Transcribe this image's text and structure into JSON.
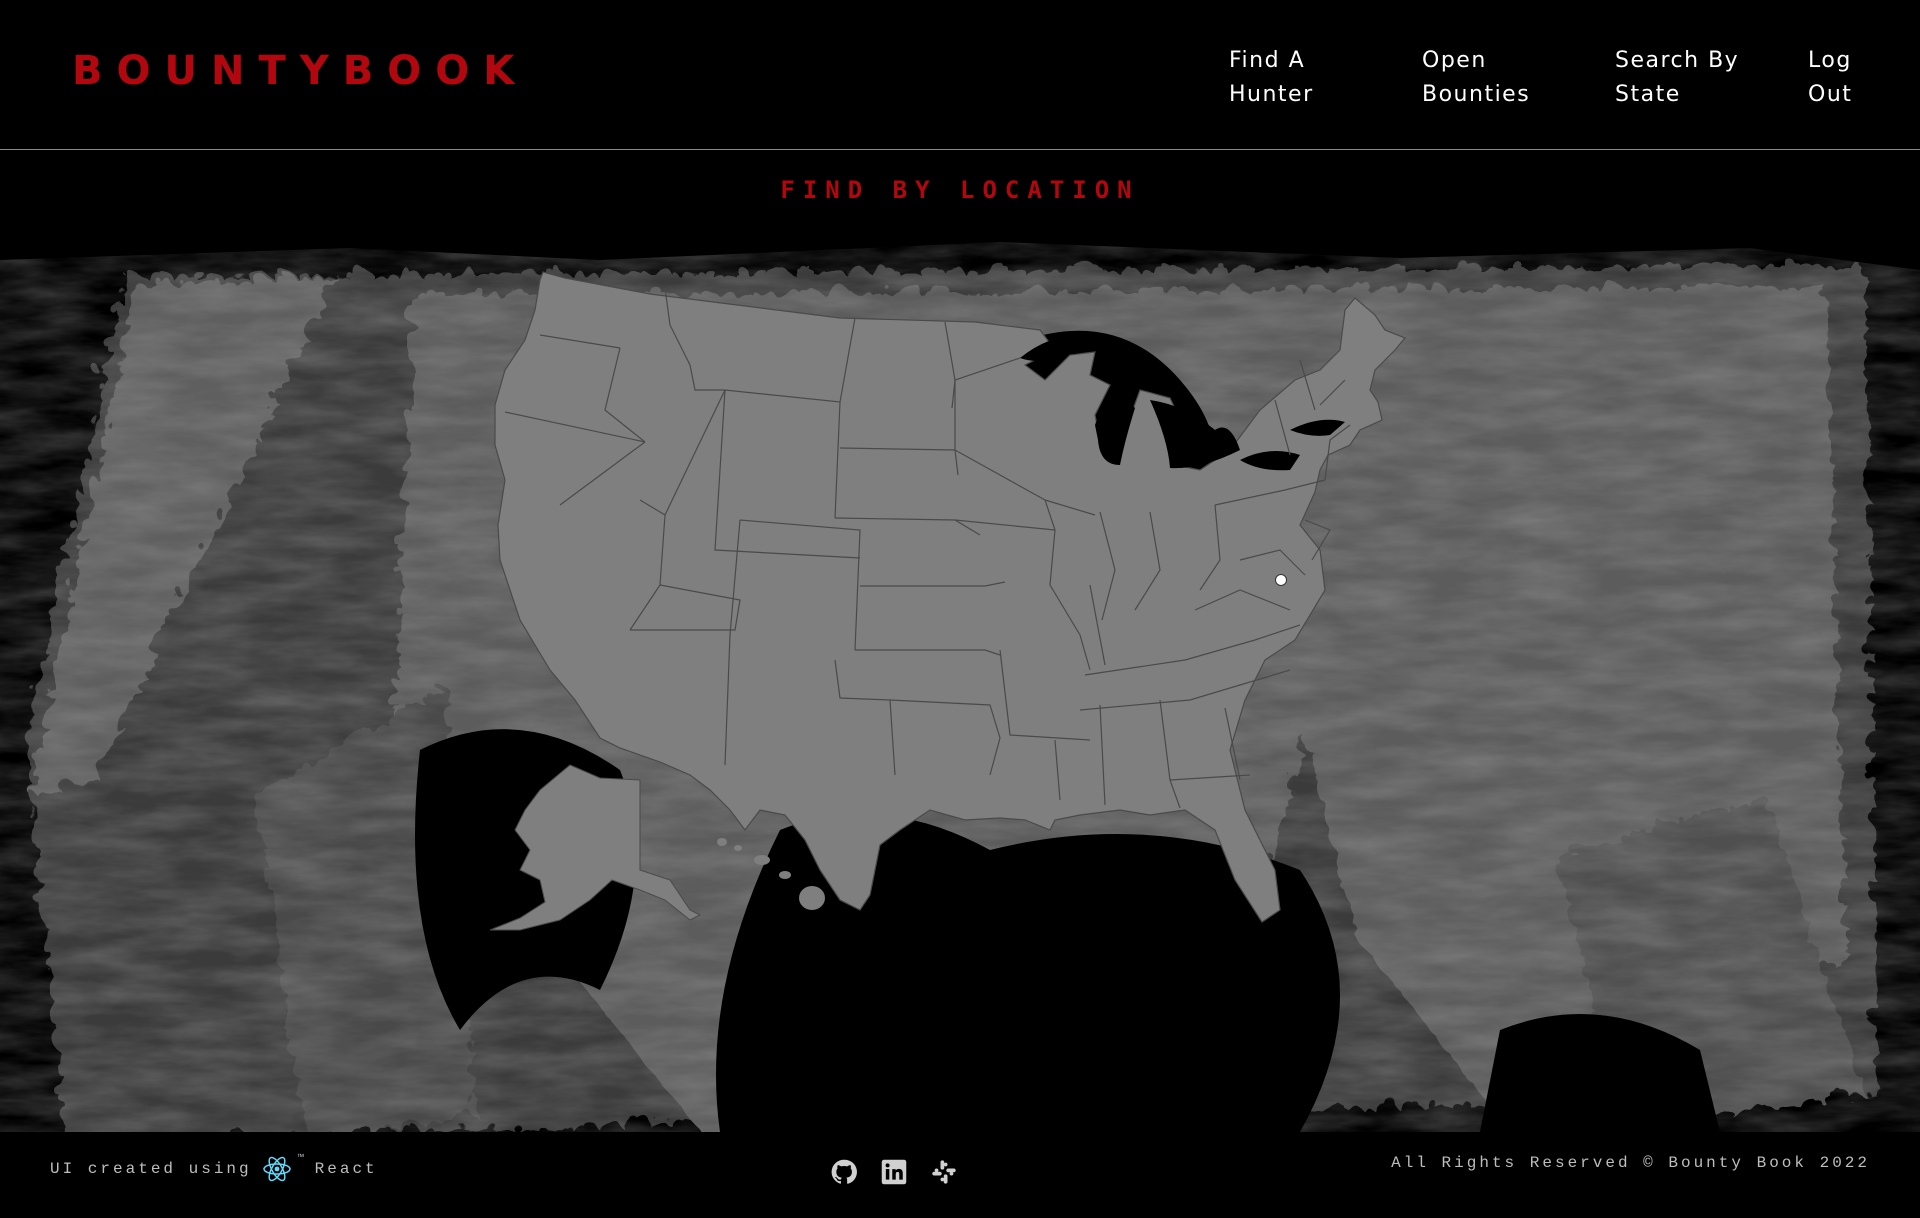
{
  "header": {
    "logo": "BOUNTYBOOK",
    "nav": [
      {
        "label": "Find A Hunter"
      },
      {
        "label": "Open Bounties"
      },
      {
        "label": "Search By State"
      },
      {
        "label": "Log Out"
      }
    ]
  },
  "main": {
    "title": "FIND BY LOCATION",
    "map": {
      "marker_icon": "location-dot-icon",
      "background": "grunge-brush-texture"
    }
  },
  "footer": {
    "credit_prefix": "UI created using",
    "credit_tm": "™",
    "credit_tech": "React",
    "tech_icon": "react-atom-icon",
    "socials": [
      {
        "icon": "github-icon"
      },
      {
        "icon": "linkedin-icon"
      },
      {
        "icon": "slack-icon"
      }
    ],
    "rights": "All Rights Reserved © Bounty Book 2022"
  },
  "colors": {
    "brand_red": "#b3070f",
    "background": "#000000",
    "map_fill": "#7f7f7f",
    "react_blue": "#61dafb"
  }
}
